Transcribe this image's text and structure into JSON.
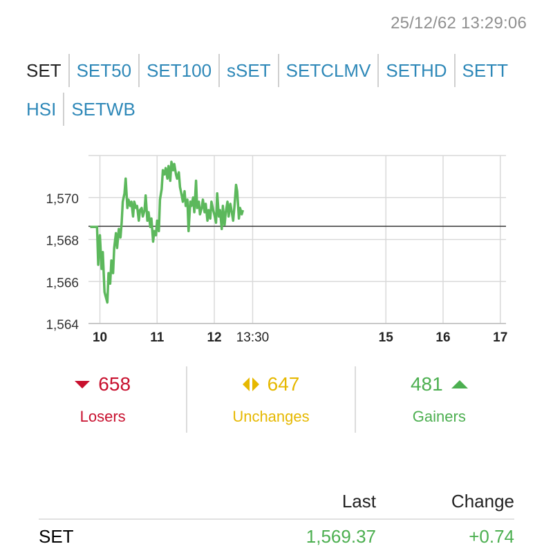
{
  "timestamp": "25/12/62 13:29:06",
  "tabs": [
    {
      "label": "SET",
      "active": true
    },
    {
      "label": "SET50",
      "active": false
    },
    {
      "label": "SET100",
      "active": false
    },
    {
      "label": "sSET",
      "active": false
    },
    {
      "label": "SETCLMV",
      "active": false
    },
    {
      "label": "SETHD",
      "active": false
    },
    {
      "label": "SETT",
      "active": false
    },
    {
      "label": "HSI",
      "active": false
    },
    {
      "label": "SETWB",
      "active": false
    }
  ],
  "chart_data": {
    "type": "line",
    "title": "",
    "xlabel": "",
    "ylabel": "",
    "x_ticks": [
      {
        "label": "10",
        "value": 10
      },
      {
        "label": "11",
        "value": 11
      },
      {
        "label": "12",
        "value": 12
      },
      {
        "label": "13:30",
        "value": 12.67
      },
      {
        "label": "15",
        "value": 15
      },
      {
        "label": "16",
        "value": 16
      },
      {
        "label": "17",
        "value": 17
      }
    ],
    "y_ticks": [
      "1,564",
      "1,566",
      "1,568",
      "1,570"
    ],
    "y_tick_values": [
      1564,
      1566,
      1568,
      1570
    ],
    "xlim": [
      9.8,
      17.1
    ],
    "ylim": [
      1564,
      1572
    ],
    "baseline": 1568.63,
    "line_color": "#5cb85c",
    "baseline_color": "#333333",
    "grid": true,
    "series": [
      {
        "x": [
          9.83,
          9.95,
          9.97,
          10.0,
          10.03,
          10.05,
          10.08,
          10.1,
          10.13,
          10.15,
          10.18,
          10.2,
          10.23,
          10.25,
          10.28,
          10.3,
          10.33,
          10.36,
          10.38,
          10.4,
          10.43,
          10.45,
          10.48,
          10.5,
          10.53,
          10.55,
          10.58,
          10.6,
          10.63,
          10.65,
          10.68,
          10.7,
          10.73,
          10.75,
          10.78,
          10.8,
          10.83,
          10.85,
          10.88,
          10.9,
          10.93,
          10.95,
          10.98,
          11.0,
          11.03,
          11.05,
          11.08,
          11.1,
          11.13,
          11.15,
          11.18,
          11.2,
          11.23,
          11.25,
          11.28,
          11.3,
          11.33,
          11.35,
          11.38,
          11.4,
          11.43,
          11.45,
          11.48,
          11.5,
          11.53,
          11.55,
          11.58,
          11.6,
          11.63,
          11.65,
          11.68,
          11.7,
          11.73,
          11.75,
          11.78,
          11.8,
          11.83,
          11.85,
          11.88,
          11.9,
          11.93,
          11.95,
          11.98,
          12.0,
          12.03,
          12.05,
          12.08,
          12.1,
          12.13,
          12.15,
          12.18,
          12.2,
          12.23,
          12.25,
          12.28,
          12.3,
          12.33,
          12.35,
          12.38,
          12.4,
          12.43,
          12.45,
          12.48,
          12.5
        ],
        "y": [
          1568.6,
          1568.6,
          1566.8,
          1568.2,
          1566.6,
          1567.4,
          1565.5,
          1565.3,
          1565.0,
          1566.4,
          1565.9,
          1567.0,
          1566.4,
          1567.6,
          1568.3,
          1567.6,
          1568.5,
          1568.1,
          1568.8,
          1569.8,
          1570.2,
          1570.9,
          1569.5,
          1569.9,
          1569.6,
          1569.8,
          1569.1,
          1569.8,
          1569.5,
          1569.6,
          1568.9,
          1569.4,
          1569.5,
          1569.1,
          1569.4,
          1570.1,
          1568.9,
          1569.3,
          1568.6,
          1569.0,
          1567.9,
          1568.4,
          1568.2,
          1568.9,
          1568.4,
          1569.9,
          1570.4,
          1571.3,
          1571.1,
          1571.4,
          1570.9,
          1571.5,
          1570.8,
          1571.7,
          1571.3,
          1571.6,
          1571.1,
          1570.9,
          1571.2,
          1570.5,
          1570.1,
          1569.8,
          1570.3,
          1569.6,
          1569.9,
          1568.4,
          1569.8,
          1569.6,
          1570.0,
          1569.3,
          1570.8,
          1569.5,
          1569.8,
          1569.2,
          1569.5,
          1569.9,
          1569.3,
          1569.7,
          1568.9,
          1569.4,
          1569.0,
          1569.8,
          1569.4,
          1569.2,
          1568.8,
          1570.2,
          1569.1,
          1569.4,
          1568.5,
          1569.6,
          1568.7,
          1569.3,
          1569.8,
          1569.1,
          1569.7,
          1569.4,
          1568.9,
          1569.5,
          1570.6,
          1570.3,
          1569.0,
          1569.5,
          1569.2,
          1569.4
        ]
      }
    ]
  },
  "stats": {
    "losers": {
      "count": "658",
      "label": "Losers",
      "color": "#c8102e"
    },
    "unchanges": {
      "count": "647",
      "label": "Unchanges",
      "color": "#e6b800"
    },
    "gainers": {
      "count": "481",
      "label": "Gainers",
      "color": "#4caf50"
    }
  },
  "table": {
    "headers": {
      "name": "",
      "last": "Last",
      "change": "Change"
    },
    "rows": [
      {
        "name": "SET",
        "last": "1,569.37",
        "change": "+0.74",
        "color": "#4caf50"
      }
    ]
  }
}
